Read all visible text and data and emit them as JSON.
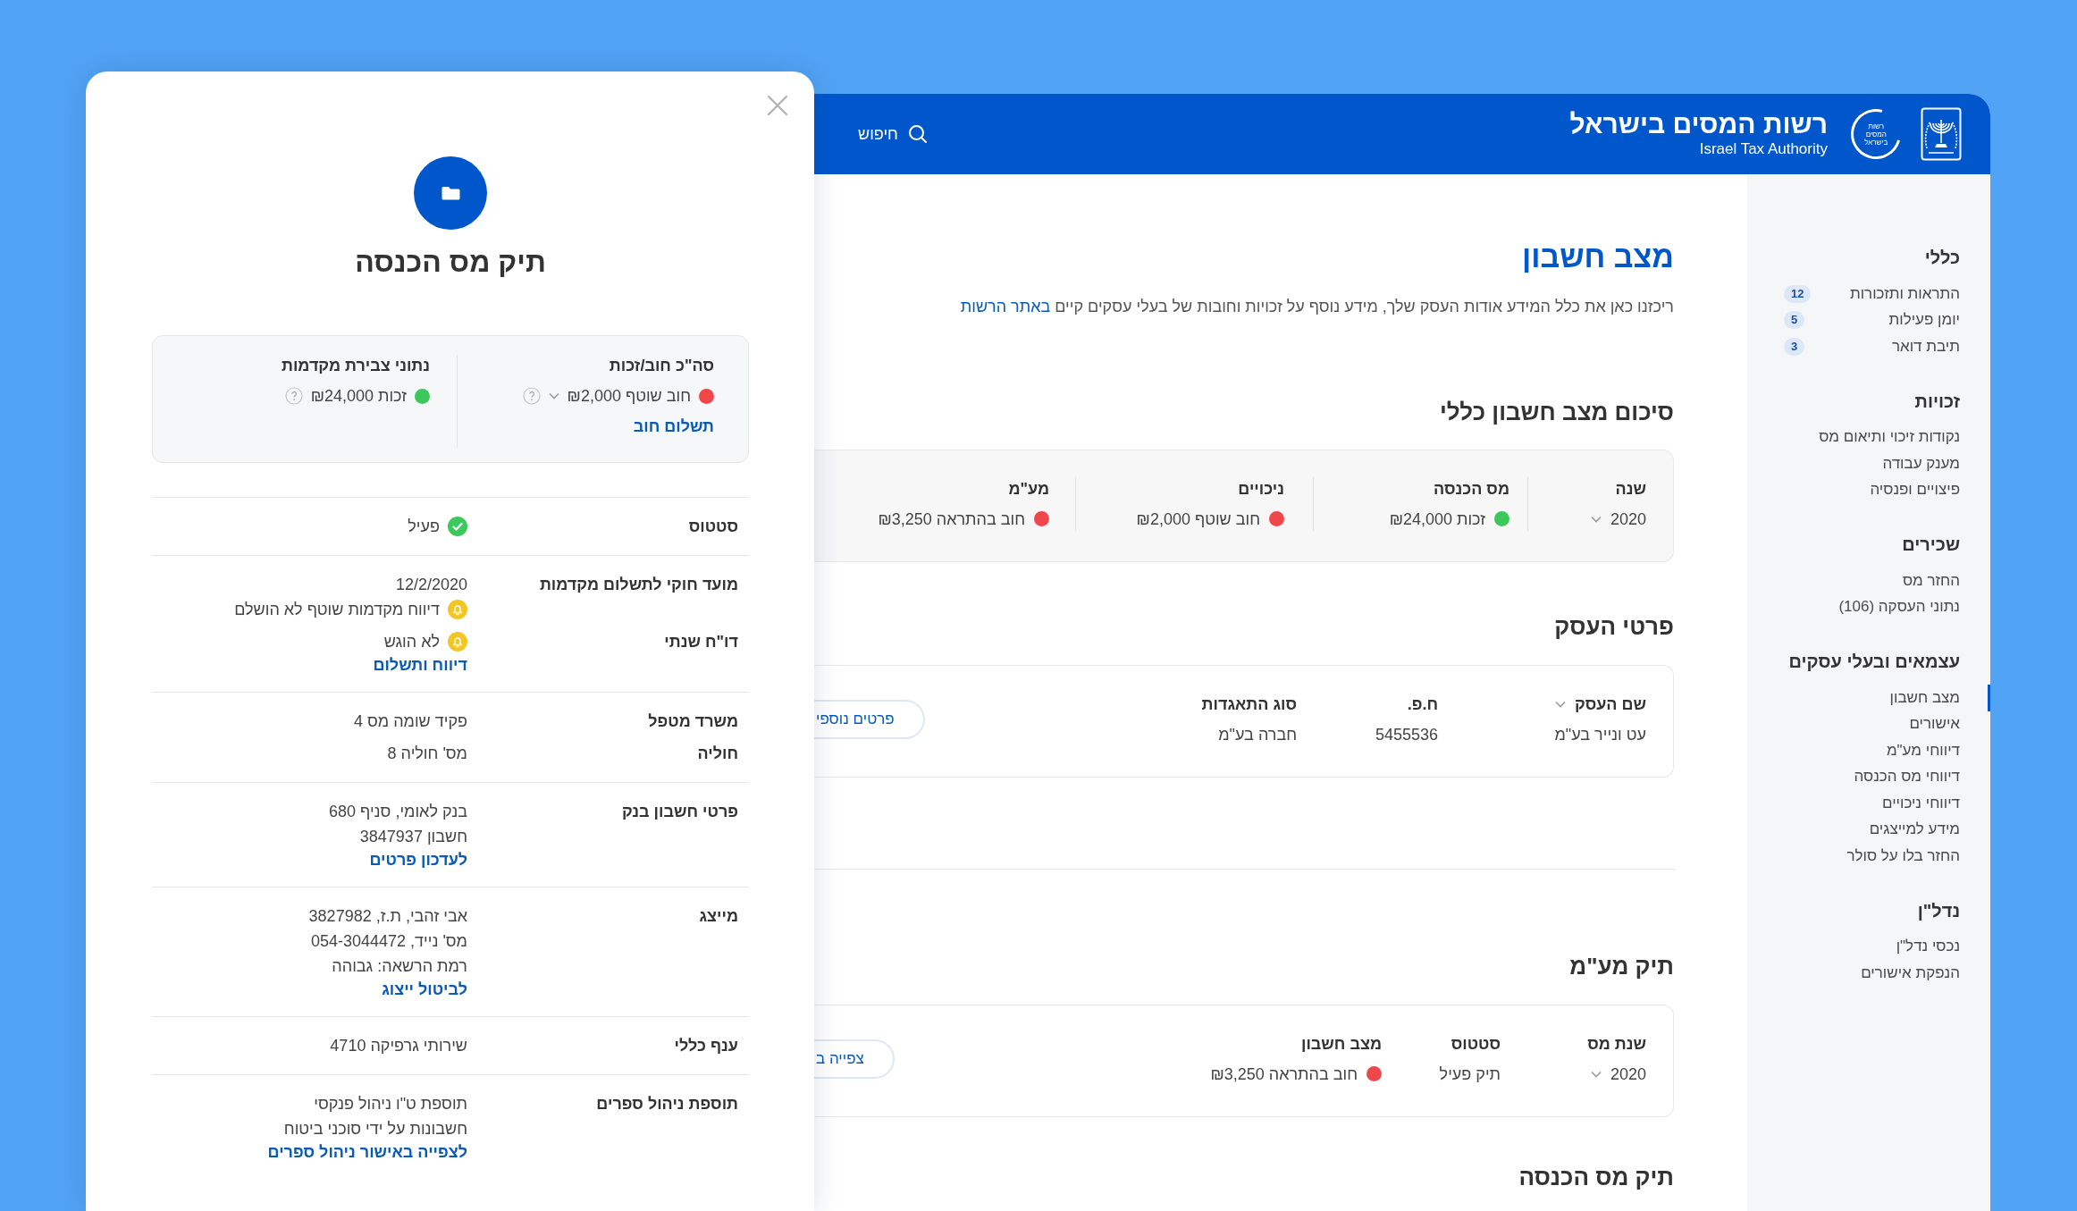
{
  "header": {
    "title": "רשות המסים בישראל",
    "subtitle": "Israel Tax Authority",
    "logo_text": "רשות המסים בישראל",
    "search": "חיפוש"
  },
  "sidebar": [
    {
      "heading": "כללי",
      "items": [
        {
          "label": "התראות ותזכורות",
          "badge": "12",
          "selected": false
        },
        {
          "label": "יומן פעילות",
          "badge": "5",
          "selected": false
        },
        {
          "label": "תיבת דואר",
          "badge": "3",
          "selected": false
        }
      ]
    },
    {
      "heading": "זכויות",
      "items": [
        {
          "label": "נקודות זיכוי ותיאום מס",
          "selected": false
        },
        {
          "label": "מענק עבודה",
          "selected": false
        },
        {
          "label": "פיצויים ופנסיה",
          "selected": false
        }
      ]
    },
    {
      "heading": "שכירים",
      "items": [
        {
          "label": "החזר מס",
          "selected": false
        },
        {
          "label": "נתוני העסקה (106)",
          "selected": false
        }
      ]
    },
    {
      "heading": "עצמאים ובעלי עסקים",
      "items": [
        {
          "label": "מצב חשבון",
          "selected": true
        },
        {
          "label": "אישורים",
          "selected": false
        },
        {
          "label": "דיווחי מע\"מ",
          "selected": false
        },
        {
          "label": "דיווחי מס הכנסה",
          "selected": false
        },
        {
          "label": "דיווחי ניכויים",
          "selected": false
        },
        {
          "label": "מידע למייצגים",
          "selected": false
        },
        {
          "label": "החזר בלו על סולר",
          "selected": false
        }
      ]
    },
    {
      "heading": "נדל\"ן",
      "items": [
        {
          "label": "נכסי נדל\"ן",
          "selected": false
        },
        {
          "label": "הנפקת אישורים",
          "selected": false
        }
      ]
    }
  ],
  "page": {
    "title": "מצב חשבון",
    "description": "ריכזנו כאן את כלל המידע אודות העסק שלך, מידע נוסף על זכויות וחובות של בעלי עסקים קיים",
    "description_link": "באתר הרשות"
  },
  "summary": {
    "heading": "סיכום מצב חשבון כללי",
    "columns": [
      {
        "label": "שנה",
        "value": "2020",
        "kind": "select"
      },
      {
        "label": "מס הכנסה",
        "value": "זכות ₪24,000",
        "kind": "status",
        "color": "#3cc85a"
      },
      {
        "label": "ניכויים",
        "value": "חוב שוטף ₪2,000",
        "kind": "status",
        "color": "#f0474b"
      },
      {
        "label": "מע\"מ",
        "value": "חוב בהתראה ₪3,250",
        "kind": "status",
        "color": "#f0474b"
      }
    ]
  },
  "business": {
    "heading": "פרטי העסק",
    "columns": [
      {
        "label": "שם העסק",
        "value": "עט ונייר בע\"מ",
        "kind": "label-select"
      },
      {
        "label": "ח.פ.",
        "value": "5455536",
        "kind": "text"
      },
      {
        "label": "סוג התאגדות",
        "value": "חברה בע\"מ",
        "kind": "text"
      }
    ],
    "button": "פרטים נוספי"
  },
  "vat": {
    "heading": "תיק מע\"מ",
    "columns": [
      {
        "label": "שנת מס",
        "value": "2020",
        "kind": "select"
      },
      {
        "label": "סטטוס",
        "value": "תיק פעיל",
        "kind": "text"
      },
      {
        "label": "מצב חשבון",
        "value": "חוב בהתראה ₪3,250",
        "kind": "status",
        "color": "#f0474b"
      }
    ],
    "button": "צפייה ב"
  },
  "income_heading": "תיק מס הכנסה",
  "drawer": {
    "title": "תיק מס הכנסה",
    "summary": [
      {
        "label": "סה\"כ חוב/זכות",
        "value": "חוב שוטף ₪2,000",
        "color": "#f0474b",
        "kind": "select",
        "link": "תשלום חוב"
      },
      {
        "label": "נתוני צבירת מקדמות",
        "value": "זכות ₪24,000",
        "color": "#3cc85a",
        "kind": "plain"
      }
    ],
    "groups": [
      {
        "rows": [
          {
            "label": "סטטוס",
            "lines": [
              {
                "text": "פעיל",
                "kind": "check"
              }
            ]
          }
        ]
      },
      {
        "rows": [
          {
            "label": "מועד חוקי לתשלום מקדמות",
            "lines": [
              {
                "text": "12/2/2020",
                "kind": "text"
              },
              {
                "text": "דיווח מקדמות שוטף לא הושלם",
                "kind": "bell"
              }
            ]
          },
          {
            "label": "דו\"ח שנתי",
            "lines": [
              {
                "text": "לא הוגש",
                "kind": "bell"
              }
            ],
            "link": "דיווח ותשלום"
          }
        ]
      },
      {
        "rows": [
          {
            "label": "משרד מטפל",
            "lines": [
              {
                "text": "פקיד שומה מס 4",
                "kind": "text"
              }
            ]
          },
          {
            "label": "חוליה",
            "lines": [
              {
                "text": "מס' חוליה 8",
                "kind": "text"
              }
            ]
          }
        ]
      },
      {
        "rows": [
          {
            "label": "פרטי חשבון בנק",
            "lines": [
              {
                "text": "בנק לאומי, סניף 680",
                "kind": "text"
              },
              {
                "text": "חשבון 3847937",
                "kind": "text"
              }
            ],
            "link": "לעדכון פרטים"
          }
        ]
      },
      {
        "rows": [
          {
            "label": "מייצג",
            "lines": [
              {
                "text": "אבי זהבי, ת.ז, 3827982",
                "kind": "text"
              },
              {
                "text": "מס' נייד, 054-3044472",
                "kind": "text"
              },
              {
                "text": "רמת הרשאה: גבוהה",
                "kind": "text"
              }
            ],
            "link": "לביטול ייצוג"
          }
        ]
      },
      {
        "rows": [
          {
            "label": "ענף כללי",
            "lines": [
              {
                "text": "שירותי גרפיקה 4710",
                "kind": "text"
              }
            ]
          }
        ]
      },
      {
        "rows": [
          {
            "label": "תוספת ניהול ספרים",
            "lines": [
              {
                "text": "תוספת ט\"ו ניהול פנקסי",
                "kind": "text"
              },
              {
                "text": "חשבונות על ידי סוכני ביטוח",
                "kind": "text"
              }
            ],
            "link": "לצפייה באישור ניהול ספרים"
          }
        ]
      }
    ]
  }
}
